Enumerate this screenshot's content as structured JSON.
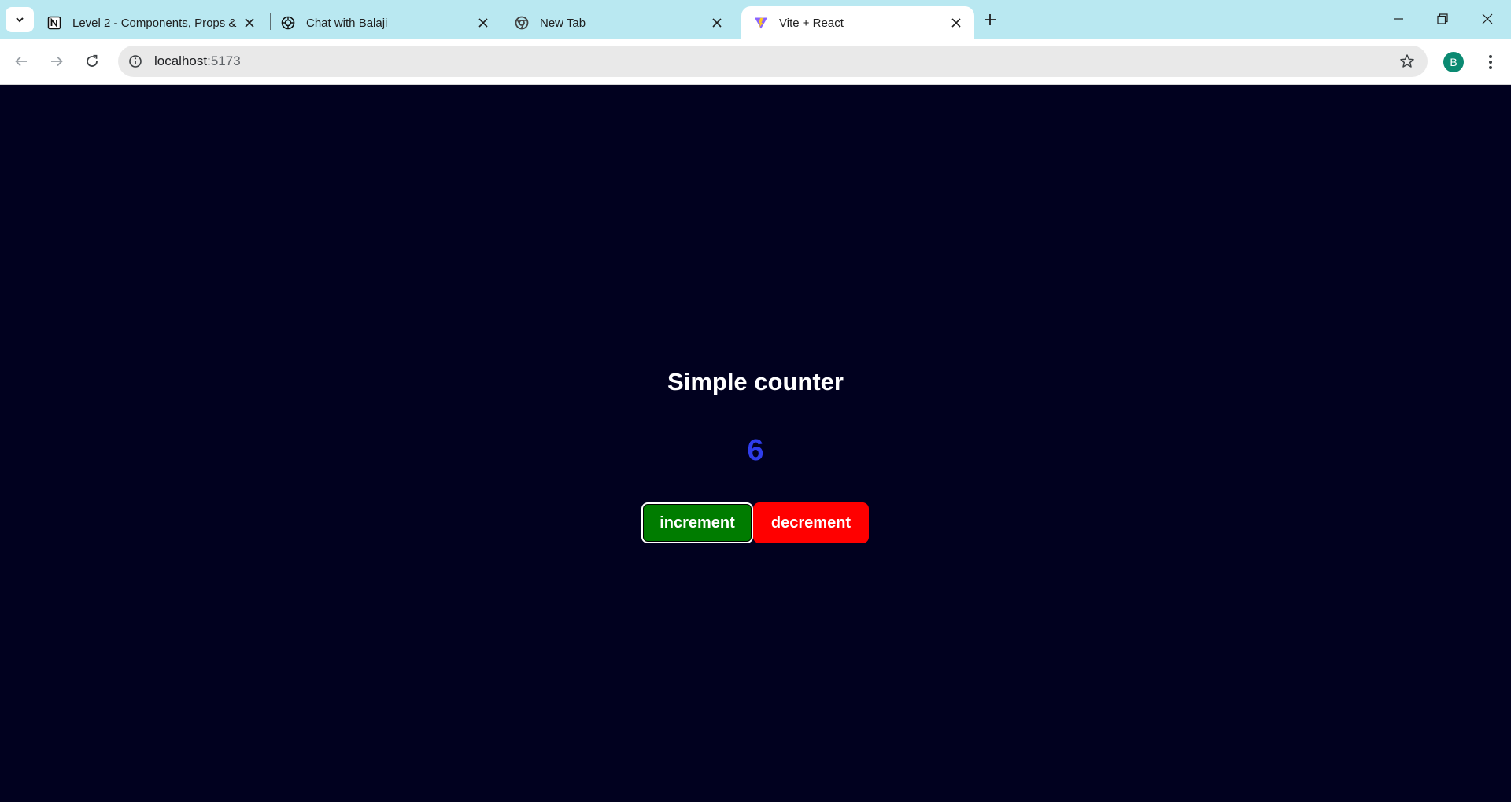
{
  "browser": {
    "tabs": [
      {
        "title": "Level 2 - Components, Props &",
        "icon": "notion-icon",
        "active": false
      },
      {
        "title": "Chat with Balaji",
        "icon": "chatgpt-icon",
        "active": false
      },
      {
        "title": "New Tab",
        "icon": "chrome-icon",
        "active": false
      },
      {
        "title": "Vite + React",
        "icon": "vite-icon",
        "active": true
      }
    ],
    "url_host": "localhost",
    "url_port": ":5173",
    "profile_initial": "B",
    "colors": {
      "tab_strip": "#b9e8f1",
      "avatar": "#0b8a72"
    }
  },
  "app": {
    "heading": "Simple counter",
    "count": "6",
    "increment_label": "increment",
    "decrement_label": "decrement",
    "colors": {
      "background": "#01011f",
      "count": "#2f3dea",
      "increment": "#007c00",
      "decrement": "#ff0000"
    }
  }
}
